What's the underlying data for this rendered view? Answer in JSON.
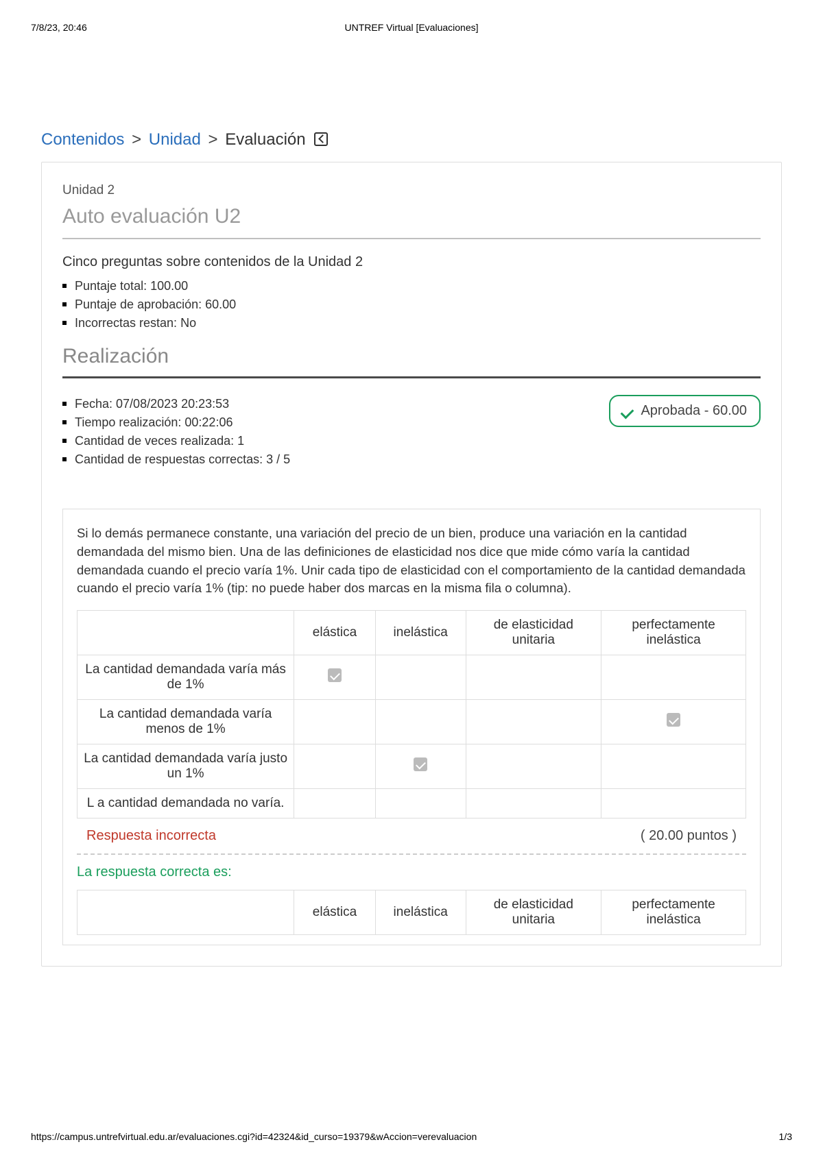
{
  "print_header": {
    "datetime": "7/8/23, 20:46",
    "title": "UNTREF Virtual [Evaluaciones]"
  },
  "breadcrumb": {
    "contenidos": "Contenidos",
    "unidad": "Unidad",
    "evaluacion": "Evaluación"
  },
  "header": {
    "unit_label": "Unidad 2",
    "eval_title": "Auto evaluación U2",
    "description": "Cinco preguntas sobre contenidos de la Unidad 2",
    "info": [
      "Puntaje total: 100.00",
      "Puntaje de aprobación: 60.00",
      "Incorrectas restan: No"
    ]
  },
  "realization": {
    "heading": "Realización",
    "items": [
      "Fecha: 07/08/2023 20:23:53",
      "Tiempo realización: 00:22:06",
      "Cantidad de veces realizada: 1",
      "Cantidad de respuestas correctas: 3 / 5"
    ],
    "status_text": "Aprobada - 60.00"
  },
  "question": {
    "text": "Si lo demás permanece constante, una variación del precio de un bien, produce una variación en la cantidad demandada del mismo bien. Una de las definiciones de elasticidad nos dice que mide cómo varía la cantidad demandada cuando el precio varía 1%. Unir cada tipo de elasticidad con el comportamiento de la cantidad demandada cuando el precio varía 1% (tip: no puede haber dos marcas en la misma fila o columna).",
    "columns": [
      "",
      "elástica",
      "inelástica",
      "de elasticidad unitaria",
      "perfectamente inelástica"
    ],
    "rows": [
      {
        "label": "La cantidad demandada varía más de 1%",
        "checks": [
          true,
          false,
          false,
          false
        ]
      },
      {
        "label": "La cantidad demandada varía menos de 1%",
        "checks": [
          false,
          false,
          false,
          true
        ]
      },
      {
        "label": "La cantidad demandada varía justo un 1%",
        "checks": [
          false,
          true,
          false,
          false
        ]
      },
      {
        "label": "L a cantidad demandada no varía.",
        "checks": [
          false,
          false,
          false,
          false
        ]
      }
    ],
    "result_label": "Respuesta incorrecta",
    "points_label": "( 20.00 puntos )",
    "correct_label": "La respuesta correcta es:",
    "correct_columns": [
      "",
      "elástica",
      "inelástica",
      "de elasticidad unitaria",
      "perfectamente inelástica"
    ]
  },
  "print_footer": {
    "url": "https://campus.untrefvirtual.edu.ar/evaluaciones.cgi?id=42324&id_curso=19379&wAccion=verevaluacion",
    "page": "1/3"
  }
}
